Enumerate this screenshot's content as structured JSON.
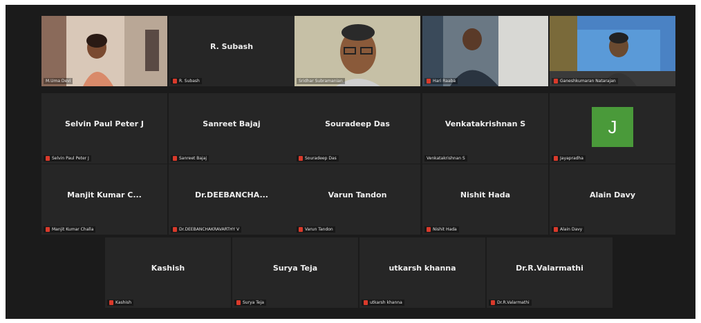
{
  "rows": [
    [
      {
        "tile": "M.Uma Devi",
        "label": "M.Uma Devi",
        "muted": false,
        "video": true,
        "scene": "woman"
      },
      {
        "tile": "R. Subash",
        "label": "R. Subash",
        "muted": true,
        "video": false
      },
      {
        "tile": "Sridhar Subramanian",
        "label": "Sridhar Subramanian",
        "muted": false,
        "video": true,
        "active": true,
        "scene": "man-glasses"
      },
      {
        "tile": "Hari Raaba",
        "label": "Hari Raaba",
        "muted": true,
        "video": true,
        "scene": "man-room"
      },
      {
        "tile": "Ganeshkumaran Natarajan",
        "label": "Ganeshkumaran Natarajan",
        "muted": true,
        "video": true,
        "scene": "man-building"
      }
    ],
    [
      {
        "tile": "Selvin Paul Peter J",
        "label": "Selvin Paul Peter J",
        "muted": true,
        "video": false
      },
      {
        "tile": "Sanreet Bajaj",
        "label": "Sanreet Bajaj",
        "muted": true,
        "video": false
      },
      {
        "tile": "Souradeep Das",
        "label": "Souradeep Das",
        "muted": true,
        "video": false
      },
      {
        "tile": "Venkatakrishnan S",
        "label": "Venkatakrishnan S",
        "muted": false,
        "video": false
      },
      {
        "tile": "J",
        "label": "Jayapradha",
        "muted": true,
        "video": false,
        "avatar": "J",
        "avatar_color": "#4a9a3a"
      }
    ],
    [
      {
        "tile": "Manjit Kumar C...",
        "label": "Manjit Kumar Challa",
        "muted": true,
        "video": false
      },
      {
        "tile": "Dr.DEEBANCHA...",
        "label": "Dr.DEEBANCHAKRAVARTHY V",
        "muted": true,
        "video": false
      },
      {
        "tile": "Varun Tandon",
        "label": "Varun Tandon",
        "muted": true,
        "video": false
      },
      {
        "tile": "Nishit Hada",
        "label": "Nishit Hada",
        "muted": true,
        "video": false
      },
      {
        "tile": "Alain Davy",
        "label": "Alain Davy",
        "muted": true,
        "video": false
      }
    ],
    [
      {
        "tile": "Kashish",
        "label": "Kashish",
        "muted": true,
        "video": false
      },
      {
        "tile": "Surya Teja",
        "label": "Surya Teja",
        "muted": true,
        "video": false
      },
      {
        "tile": "utkarsh khanna",
        "label": "utkarsh khanna",
        "muted": true,
        "video": false
      },
      {
        "tile": "Dr.R.Valarmathi",
        "label": "Dr.R.Valarmathi",
        "muted": true,
        "video": false
      }
    ]
  ],
  "colors": {
    "background": "#1b1b1b",
    "tile": "#262626",
    "mute": "#d93a2b",
    "active_speaker": "#c9d63a"
  }
}
